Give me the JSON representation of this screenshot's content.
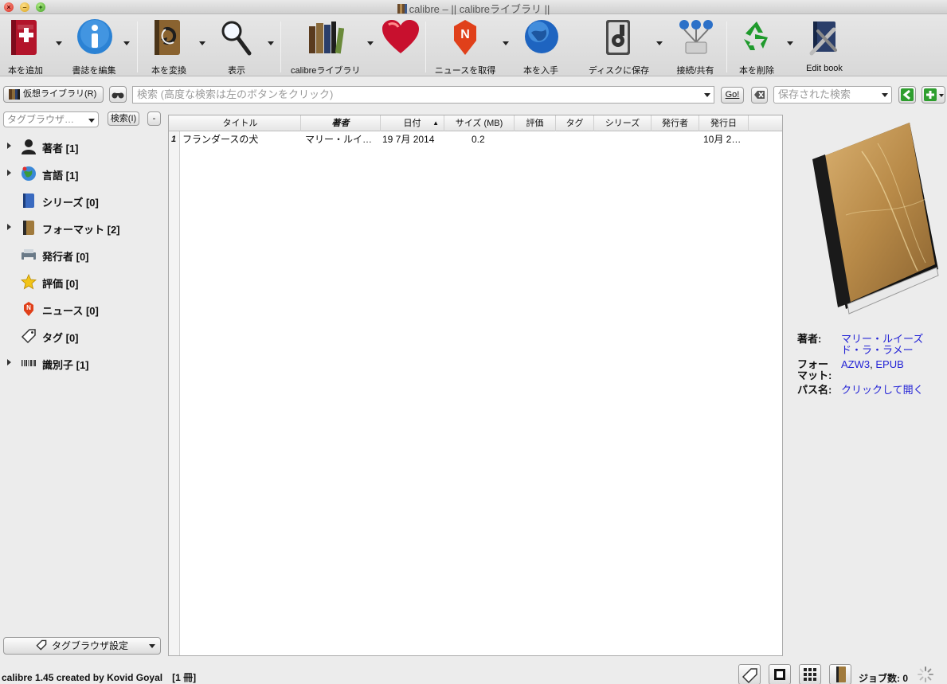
{
  "window": {
    "title": "calibre – || calibreライブラリ ||",
    "traffic_close": "×",
    "traffic_min": "–",
    "traffic_max": "+"
  },
  "toolbar": {
    "add_books": "本を追加",
    "edit_metadata": "書誌を編集",
    "convert_books": "本を変換",
    "view": "表示",
    "library": "calibreライブラリ",
    "fetch_news": "ニュースを取得",
    "get_books": "本を入手",
    "save_to_disk": "ディスクに保存",
    "connect_share": "接続/共有",
    "remove_books": "本を削除",
    "edit_book": "Edit book",
    "news_badge": "N"
  },
  "searchbar": {
    "virtual_library": "仮想ライブラリ(R)",
    "search_placeholder": "検索 (高度な検索は左のボタンをクリック)",
    "go": "Go!",
    "saved_searches_placeholder": "保存された検索"
  },
  "tag_browser": {
    "filter_placeholder": "タグブラウザ…",
    "find_button": "検索(I)",
    "collapse_button": "-",
    "config_button": "タグブラウザ設定",
    "items": [
      {
        "label": "著者 [1]",
        "icon": "author-icon",
        "expandable": true
      },
      {
        "label": "言語 [1]",
        "icon": "language-icon",
        "expandable": true
      },
      {
        "label": "シリーズ [0]",
        "icon": "series-icon",
        "expandable": false
      },
      {
        "label": "フォーマット [2]",
        "icon": "format-icon",
        "expandable": true
      },
      {
        "label": "発行者 [0]",
        "icon": "publisher-icon",
        "expandable": false
      },
      {
        "label": "評価 [0]",
        "icon": "rating-star-icon",
        "expandable": false
      },
      {
        "label": "ニュース [0]",
        "icon": "news-icon",
        "expandable": false
      },
      {
        "label": "タグ [0]",
        "icon": "tag-icon",
        "expandable": false
      },
      {
        "label": "識別子 [1]",
        "icon": "barcode-icon",
        "expandable": true
      }
    ]
  },
  "book_list": {
    "columns": [
      "タイトル",
      "著者",
      "日付",
      "サイズ (MB)",
      "評価",
      "タグ",
      "シリーズ",
      "発行者",
      "発行日"
    ],
    "sort_indicator": "▲",
    "rows": [
      {
        "num": "1",
        "title": "フランダースの犬",
        "author": "マリー・ルイ…",
        "date": "19 7月 2014",
        "size": "0.2",
        "rating": "",
        "tags": "",
        "series": "",
        "publisher": "",
        "pubdate": "10月 2…"
      }
    ]
  },
  "details": {
    "author_key": "著者:",
    "author_value_1": "マリー・ルイーズ",
    "author_value_2": "ド・ラ・ラメー",
    "formats_key_1": "フォー",
    "formats_key_2": "マット:",
    "formats_azw3": "AZW3",
    "formats_sep": ", ",
    "formats_epub": "EPUB",
    "path_key": "パス名:",
    "path_value": "クリックして開く"
  },
  "statusbar": {
    "text": "calibre 1.45 created by Kovid Goyal　[1 冊]",
    "jobs": "ジョブ数: 0"
  },
  "colors": {
    "link": "#2323d6",
    "accent_red": "#c8102e",
    "accent_blue": "#1e74c8"
  }
}
